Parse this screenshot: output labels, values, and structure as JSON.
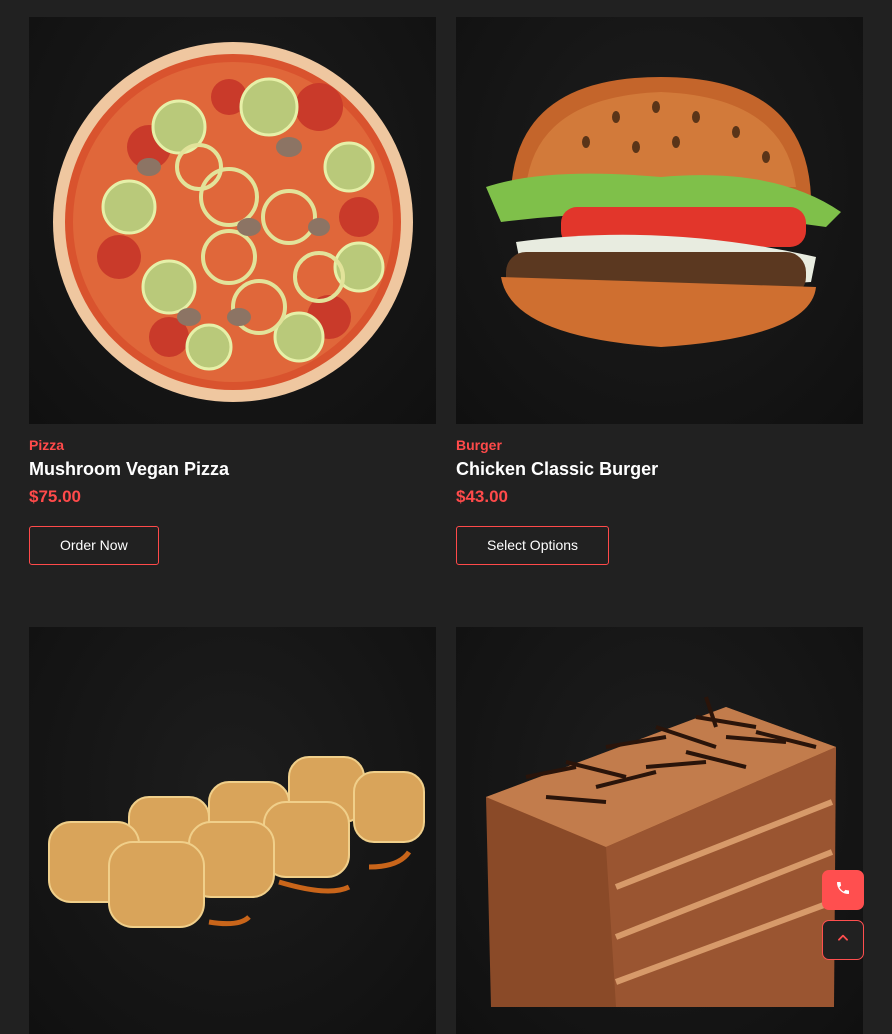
{
  "products": [
    {
      "category": "Pizza",
      "title": "Mushroom Vegan Pizza",
      "price": "$75.00",
      "button_label": "Order Now",
      "image": "pizza-image"
    },
    {
      "category": "Burger",
      "title": "Chicken Classic Burger",
      "price": "$43.00",
      "button_label": "Select Options",
      "image": "burger-image"
    },
    {
      "image": "sushi-rolls-image"
    },
    {
      "image": "chocolate-cake-image"
    }
  ],
  "floating_actions": {
    "phone_icon": "phone-icon",
    "scroll_top_icon": "chevron-up-icon"
  },
  "colors": {
    "background": "#212121",
    "accent": "#ff4a4a",
    "text": "#ffffff"
  }
}
